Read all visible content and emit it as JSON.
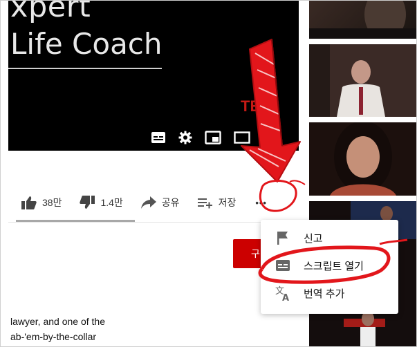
{
  "video": {
    "title_line1": "xpert",
    "title_line2": "Life Coach",
    "watermark": "TE"
  },
  "player_controls": {
    "icons": [
      "subtitles-icon",
      "settings-icon",
      "miniplayer-icon",
      "theater-icon"
    ]
  },
  "actions": {
    "like_count": "38만",
    "dislike_count": "1.4만",
    "share_label": "공유",
    "save_label": "저장",
    "more_label": "•••"
  },
  "subscribe": {
    "label": "구"
  },
  "description": {
    "line1": "lawyer, and one of the",
    "line2": "ab-'em-by-the-collar"
  },
  "menu": {
    "items": [
      {
        "label": "신고",
        "icon": "flag-icon"
      },
      {
        "label": "스크립트 열기",
        "icon": "transcript-icon"
      },
      {
        "label": "번역 추가",
        "icon": "translate-icon"
      }
    ]
  },
  "colors": {
    "accent_red": "#cc0000",
    "annotation_red": "#e2161b",
    "ted_red": "#c51a15"
  }
}
